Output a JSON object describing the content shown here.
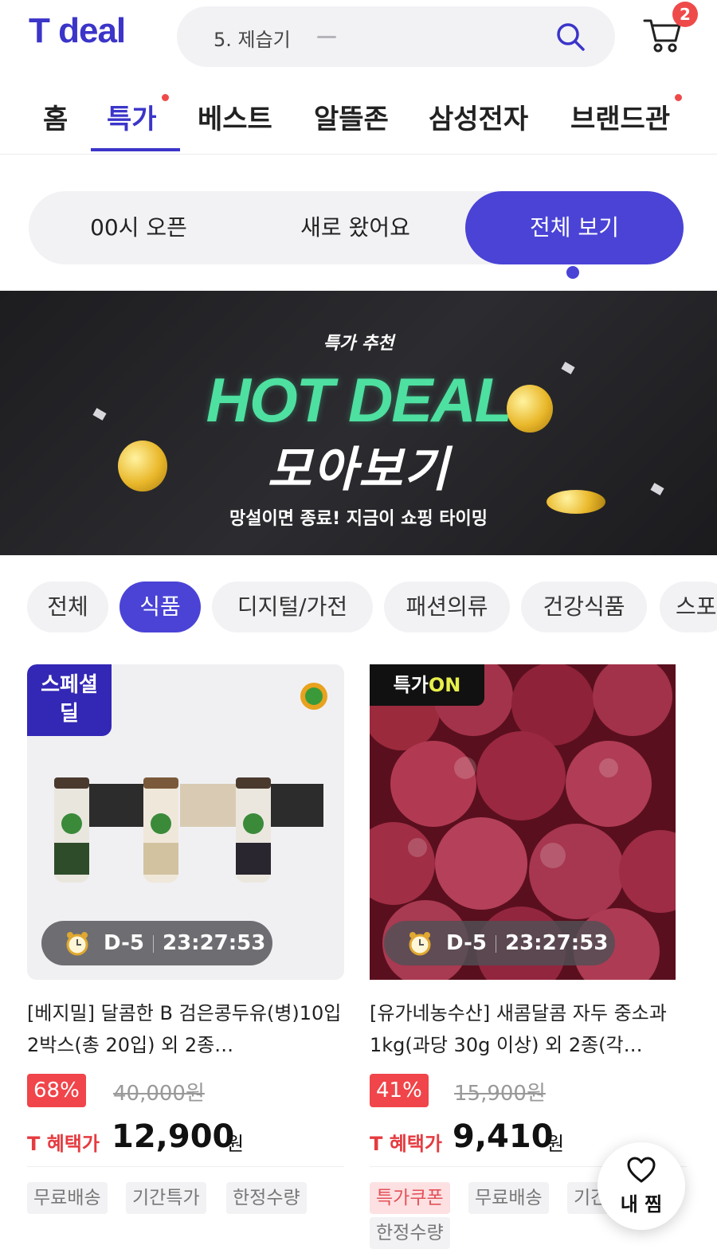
{
  "header": {
    "logo": "T deal",
    "search_text": "5. 제습기",
    "cart_count": "2"
  },
  "nav": {
    "items": [
      "홈",
      "특가",
      "베스트",
      "알뜰존",
      "삼성전자",
      "브랜드관"
    ],
    "active": "특가"
  },
  "segment": {
    "items": [
      "00시 오픈",
      "새로 왔어요",
      "전체 보기"
    ],
    "active": "전체 보기"
  },
  "banner": {
    "small": "특가 추천",
    "hot": "HOT DEAL",
    "title": "모아보기",
    "sub": "망설이면 종료! 지금이 쇼핑 타이밍"
  },
  "categories": {
    "items": [
      "전체",
      "식품",
      "디지털/가전",
      "패션의류",
      "건강식품",
      "스포"
    ],
    "active": "식품"
  },
  "products": [
    {
      "badge": "스페셜 딜",
      "badge_line1": "스페셜",
      "badge_line2": "딜",
      "timer_day": "D-5",
      "timer_time": "23:27:53",
      "title": "[베지밀] 달콤한 B 검은콩두유(병)10입 2박스(총 20입) 외 2종…",
      "discount": "68%",
      "original_price": "40,000원",
      "t_label": "T 혜택가",
      "price": "12,900",
      "unit": "원",
      "tags": [
        "무료배송",
        "기간특가",
        "한정수량"
      ]
    },
    {
      "badge_prefix": "특가",
      "badge_suffix": "ON",
      "timer_day": "D-5",
      "timer_time": "23:27:53",
      "title": "[유가네농수산] 새콤달콤 자두 중소과 1kg(과당 30g 이상) 외 2종(각…",
      "discount": "41%",
      "original_price": "15,900원",
      "t_label": "T 혜택가",
      "price": "9,410",
      "unit": "원",
      "tags": [
        "특가쿠폰",
        "무료배송",
        "기간특가",
        "한정수량"
      ],
      "tags_visible": [
        "특가쿠폰",
        "무료배송",
        "기간"
      ]
    }
  ],
  "wishlist": {
    "label": "내 찜",
    "icon": "heart-icon"
  },
  "colors": {
    "brand": "#3b35c9",
    "accent": "#4a43d6",
    "discount": "#f0454a",
    "hotdeal": "#4ee0a0"
  }
}
